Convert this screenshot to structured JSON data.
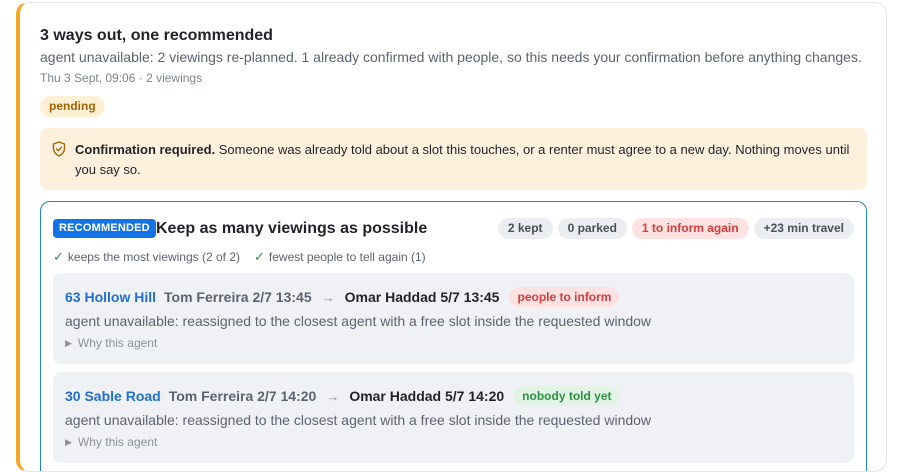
{
  "card": {
    "title": "3 ways out, one recommended",
    "description": "agent unavailable: 2 viewings re-planned. 1 already confirmed with people, so this needs your confirmation before anything changes.",
    "meta": "Thu 3 Sept, 09:06 · 2 viewings",
    "status_badge": "pending",
    "accent_color": "#f5a623"
  },
  "confirmation": {
    "icon": "shield-icon",
    "title": "Confirmation required.",
    "body": "Someone was already told about a slot this touches, or a renter must agree to a new day. Nothing moves until you say so."
  },
  "option": {
    "badge": "RECOMMENDED",
    "title": "Keep as many viewings as possible",
    "pills": [
      {
        "label": "2 kept",
        "tone": "gray"
      },
      {
        "label": "0 parked",
        "tone": "gray"
      },
      {
        "label": "1 to inform again",
        "tone": "red"
      },
      {
        "label": "+23 min travel",
        "tone": "gray"
      }
    ],
    "checks": [
      "keeps the most viewings (2 of 2)",
      "fewest people to tell again (1)"
    ],
    "rows": [
      {
        "address": "63 Hollow Hill",
        "from": "Tom Ferreira 2/7 13:45",
        "to": "Omar Haddad 5/7 13:45",
        "status": "people to inform",
        "status_tone": "red",
        "note": "agent unavailable: reassigned to the closest agent with a free slot inside the requested window",
        "why": "Why this agent"
      },
      {
        "address": "30 Sable Road",
        "from": "Tom Ferreira 2/7 14:20",
        "to": "Omar Haddad 5/7 14:20",
        "status": "nobody told yet",
        "status_tone": "green",
        "note": "agent unavailable: reassigned to the closest agent with a free slot inside the requested window",
        "why": "Why this agent"
      }
    ]
  }
}
